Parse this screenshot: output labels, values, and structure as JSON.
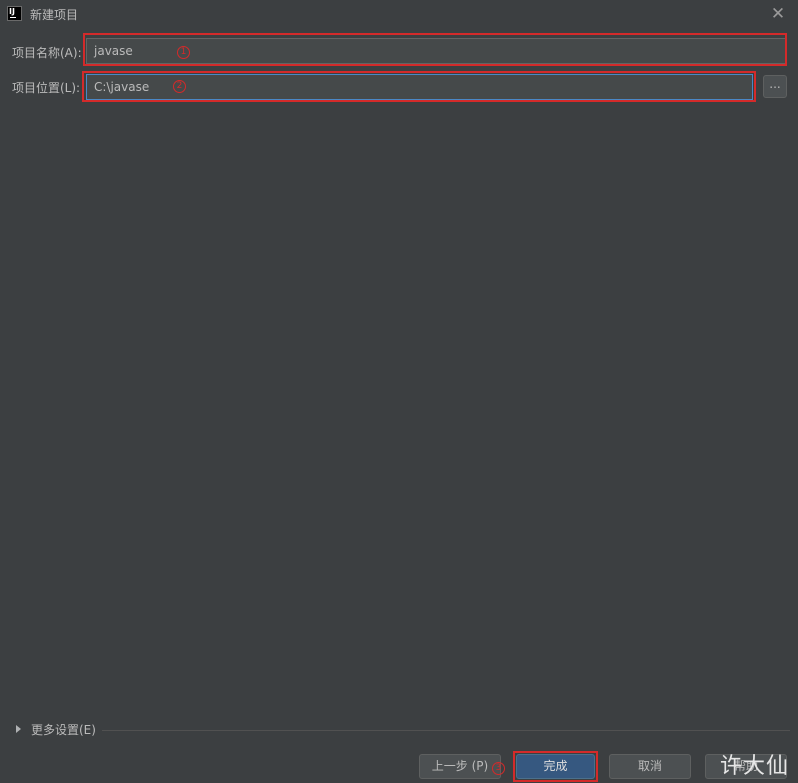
{
  "window": {
    "title": "新建项目",
    "app_icon": "intellij-idea-icon",
    "app_icon_text": "IJ",
    "close_glyph": "✕"
  },
  "form": {
    "name_label": "项目名称(A):",
    "name_value": "javase",
    "location_label": "项目位置(L):",
    "location_value": "C:\\javase",
    "browse_label": "..."
  },
  "annotations": {
    "marker_1": "1",
    "marker_2": "2",
    "marker_3": "3",
    "color": "#d42a2a"
  },
  "more_settings": {
    "label": "更多设置(E)",
    "icon": "triangle-right-icon"
  },
  "buttons": {
    "previous": "上一步 (P)",
    "finish": "完成",
    "cancel": "取消",
    "help": "帮助"
  },
  "watermark": "许大仙",
  "colors": {
    "background": "#3c3f41",
    "input_bg": "#45494a",
    "primary_button": "#365880",
    "focus_border": "#4a88c7"
  }
}
